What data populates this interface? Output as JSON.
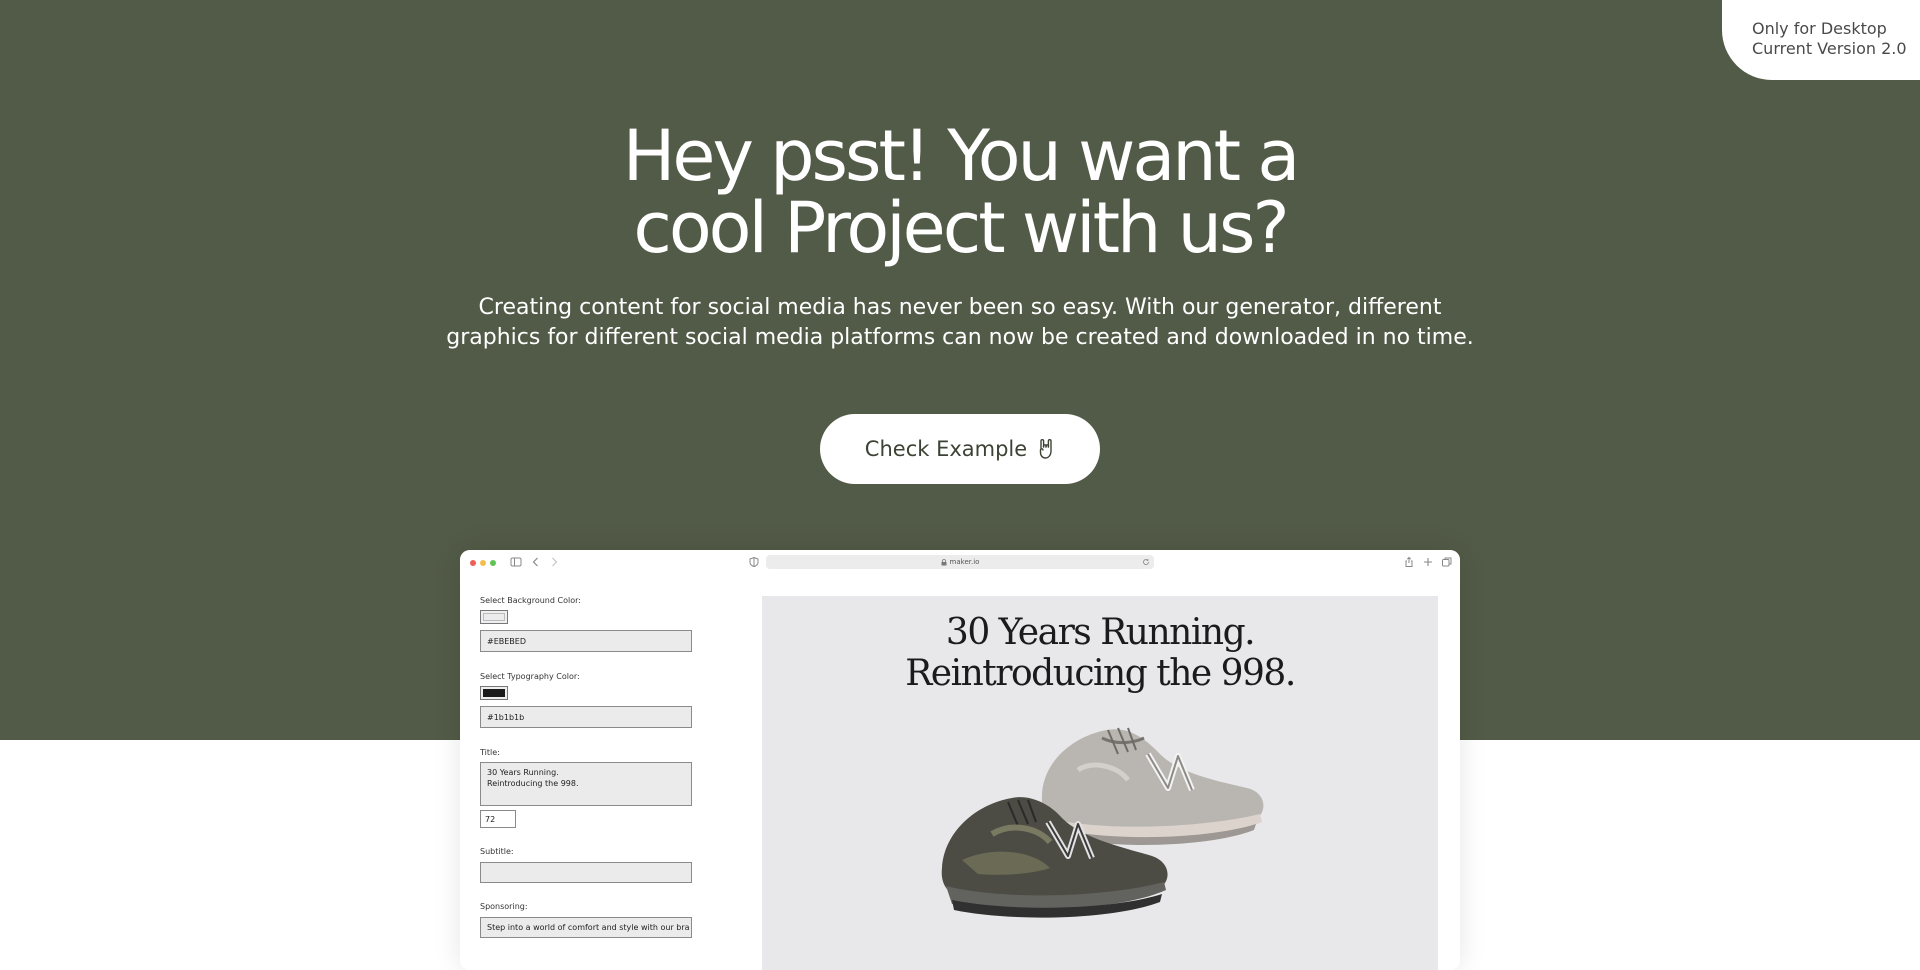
{
  "badge": {
    "line1": "Only for Desktop",
    "line2": "Current Version 2.0"
  },
  "hero": {
    "title_line1": "Hey psst! You want a",
    "title_line2": "cool Project with us?",
    "subtitle_line1": "Creating content for social media has never been so easy. With our generator, different",
    "subtitle_line2": "graphics for different social media platforms can now be created and downloaded in no time.",
    "cta_label": "Check Example"
  },
  "browser": {
    "url": "maker.io",
    "form": {
      "bg_color_label": "Select Background Color:",
      "bg_color_value": "#EBEBED",
      "typo_color_label": "Select Typography Color:",
      "typo_color_value": "#1b1b1b",
      "title_label": "Title:",
      "title_line1": "30 Years Running.",
      "title_line2": "Reintroducing the 998.",
      "title_size": "72",
      "subtitle_label": "Subtitle:",
      "subtitle_value": "",
      "sponsoring_label": "Sponsoring:",
      "sponsoring_value": "Step into a world of comfort and style with our bra"
    },
    "preview": {
      "title_line1": "30 Years Running.",
      "title_line2": "Reintroducing the 998."
    }
  },
  "colors": {
    "hero_bg": "#525b47",
    "preview_bg": "#e8e8ea",
    "typography": "#1b1b1b"
  },
  "icons": [
    "rock-hand-icon",
    "sidebar-icon",
    "back-arrow-icon",
    "forward-arrow-icon",
    "shield-icon",
    "lock-icon",
    "reload-icon",
    "share-icon",
    "new-tab-icon",
    "tabs-icon"
  ]
}
